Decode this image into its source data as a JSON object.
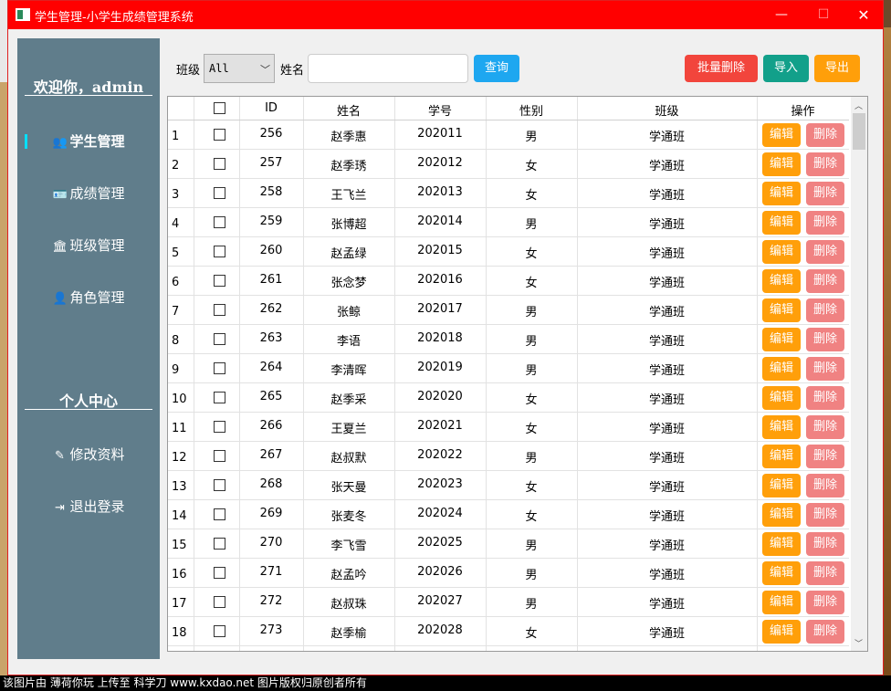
{
  "window": {
    "title": "学生管理-小学生成绩管理系统",
    "min_symbol": "—",
    "max_symbol": "☐",
    "close_symbol": "✕"
  },
  "sidebar": {
    "welcome": "欢迎你，admin",
    "items": [
      {
        "label": "学生管理",
        "icon": "users-icon",
        "glyph": "👥"
      },
      {
        "label": "成绩管理",
        "icon": "id-card-icon",
        "glyph": "🪪"
      },
      {
        "label": "班级管理",
        "icon": "institution-icon",
        "glyph": "🏛"
      },
      {
        "label": "角色管理",
        "icon": "user-secret-icon",
        "glyph": "👤"
      }
    ],
    "personal_title": "个人中心",
    "personal_items": [
      {
        "label": "修改资料",
        "icon": "edit-icon",
        "glyph": "✎"
      },
      {
        "label": "退出登录",
        "icon": "sign-out-icon",
        "glyph": "⇥"
      }
    ]
  },
  "toolbar": {
    "class_label": "班级",
    "class_value": "All",
    "name_label": "姓名",
    "name_value": "",
    "query_button": "查询",
    "batch_delete_button": "批量删除",
    "import_button": "导入",
    "export_button": "导出"
  },
  "table": {
    "headers": {
      "id": "ID",
      "name": "姓名",
      "number": "学号",
      "gender": "性别",
      "class": "班级",
      "action": "操作"
    },
    "edit_label": "编辑",
    "delete_label": "删除",
    "rows": [
      {
        "n": "1",
        "id": "256",
        "name": "赵季惠",
        "number": "202011",
        "gender": "男",
        "class": "学通班"
      },
      {
        "n": "2",
        "id": "257",
        "name": "赵季琇",
        "number": "202012",
        "gender": "女",
        "class": "学通班"
      },
      {
        "n": "3",
        "id": "258",
        "name": "王飞兰",
        "number": "202013",
        "gender": "女",
        "class": "学通班"
      },
      {
        "n": "4",
        "id": "259",
        "name": "张博超",
        "number": "202014",
        "gender": "男",
        "class": "学通班"
      },
      {
        "n": "5",
        "id": "260",
        "name": "赵孟绿",
        "number": "202015",
        "gender": "女",
        "class": "学通班"
      },
      {
        "n": "6",
        "id": "261",
        "name": "张念梦",
        "number": "202016",
        "gender": "女",
        "class": "学通班"
      },
      {
        "n": "7",
        "id": "262",
        "name": "张鲸",
        "number": "202017",
        "gender": "男",
        "class": "学通班"
      },
      {
        "n": "8",
        "id": "263",
        "name": "李语",
        "number": "202018",
        "gender": "男",
        "class": "学通班"
      },
      {
        "n": "9",
        "id": "264",
        "name": "李清晖",
        "number": "202019",
        "gender": "男",
        "class": "学通班"
      },
      {
        "n": "10",
        "id": "265",
        "name": "赵季采",
        "number": "202020",
        "gender": "女",
        "class": "学通班"
      },
      {
        "n": "11",
        "id": "266",
        "name": "王夏兰",
        "number": "202021",
        "gender": "女",
        "class": "学通班"
      },
      {
        "n": "12",
        "id": "267",
        "name": "赵叔默",
        "number": "202022",
        "gender": "男",
        "class": "学通班"
      },
      {
        "n": "13",
        "id": "268",
        "name": "张天曼",
        "number": "202023",
        "gender": "女",
        "class": "学通班"
      },
      {
        "n": "14",
        "id": "269",
        "name": "张麦冬",
        "number": "202024",
        "gender": "女",
        "class": "学通班"
      },
      {
        "n": "15",
        "id": "270",
        "name": "李飞雪",
        "number": "202025",
        "gender": "男",
        "class": "学通班"
      },
      {
        "n": "16",
        "id": "271",
        "name": "赵孟吟",
        "number": "202026",
        "gender": "男",
        "class": "学通班"
      },
      {
        "n": "17",
        "id": "272",
        "name": "赵叔珠",
        "number": "202027",
        "gender": "男",
        "class": "学通班"
      },
      {
        "n": "18",
        "id": "273",
        "name": "赵季榆",
        "number": "202028",
        "gender": "女",
        "class": "学通班"
      }
    ]
  },
  "caption": "该图片由 薄荷你玩 上传至 科学刀 www.kxdao.net 图片版权归原创者所有",
  "colors": {
    "titlebar": "#ff0000",
    "sidebar": "#607d8b",
    "query": "#1ea7f0",
    "batch_delete": "#f2453c",
    "import": "#12a08a",
    "export": "#ff9f0a",
    "edit": "#ff9f0a",
    "delete": "#f08282"
  }
}
